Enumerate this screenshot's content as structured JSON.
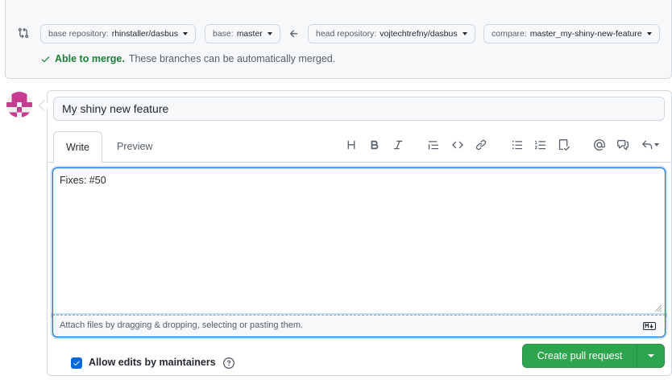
{
  "compare": {
    "base_repo_label": "base repository:",
    "base_repo_value": "rhinstaller/dasbus",
    "base_label": "base:",
    "base_value": "master",
    "head_repo_label": "head repository:",
    "head_repo_value": "vojtechtrefny/dasbus",
    "compare_label": "compare:",
    "compare_value": "master_my-shiny-new-feature",
    "merge_ok": "Able to merge.",
    "merge_msg": "These branches can be automatically merged."
  },
  "pr": {
    "title_value": "My shiny new feature",
    "tabs": {
      "write": "Write",
      "preview": "Preview"
    },
    "body_value": "Fixes: #50",
    "attach_hint": "Attach files by dragging & dropping, selecting or pasting them.",
    "toolbar": [
      "heading-icon",
      "bold-icon",
      "italic-icon",
      "quote-icon",
      "code-icon",
      "link-icon",
      "unordered-list-icon",
      "ordered-list-icon",
      "task-list-icon",
      "mention-icon",
      "reference-icon",
      "reply-icon"
    ],
    "allow_edits_label": "Allow edits by maintainers",
    "allow_edits_checked": true,
    "create_button": "Create pull request"
  },
  "colors": {
    "accent": "#0969da",
    "success": "#1a7f37",
    "button_green": "#2da44e",
    "avatar": "#c63c8e"
  }
}
